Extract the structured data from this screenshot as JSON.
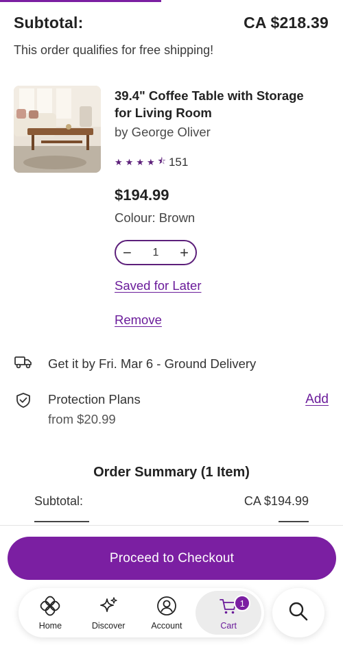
{
  "header": {
    "subtotal_label": "Subtotal:",
    "subtotal_value": "CA $218.39",
    "free_shipping_text": "This order qualifies for free shipping!"
  },
  "product": {
    "title": "39.4\" Coffee Table with Storage for Living Room",
    "brand": "by George Oliver",
    "rating": 4.5,
    "review_count": "151",
    "price": "$194.99",
    "colour": "Colour: Brown",
    "quantity": "1",
    "saved_for_later_label": "Saved for Later",
    "remove_label": "Remove"
  },
  "delivery": {
    "text": "Get it by Fri. Mar 6 - Ground Delivery",
    "icon": "truck-icon"
  },
  "protection": {
    "title": "Protection Plans",
    "price": "from $20.99",
    "add_label": "Add",
    "icon": "shield-check-icon"
  },
  "order_summary": {
    "title": "Order Summary (1 Item)",
    "subtotal_label": "Subtotal:",
    "subtotal_value": "CA $194.99"
  },
  "checkout": {
    "label": "Proceed to Checkout"
  },
  "bottom_nav": {
    "items": [
      {
        "label": "Home",
        "icon": "home-icon"
      },
      {
        "label": "Discover",
        "icon": "sparkle-icon"
      },
      {
        "label": "Account",
        "icon": "account-icon"
      },
      {
        "label": "Cart",
        "icon": "cart-icon",
        "active": true,
        "badge": "1"
      }
    ],
    "search_icon": "search-icon"
  },
  "colors": {
    "accent": "#7b1fa2",
    "accent_text": "#6a1b9a",
    "star": "#5c1f7a"
  }
}
